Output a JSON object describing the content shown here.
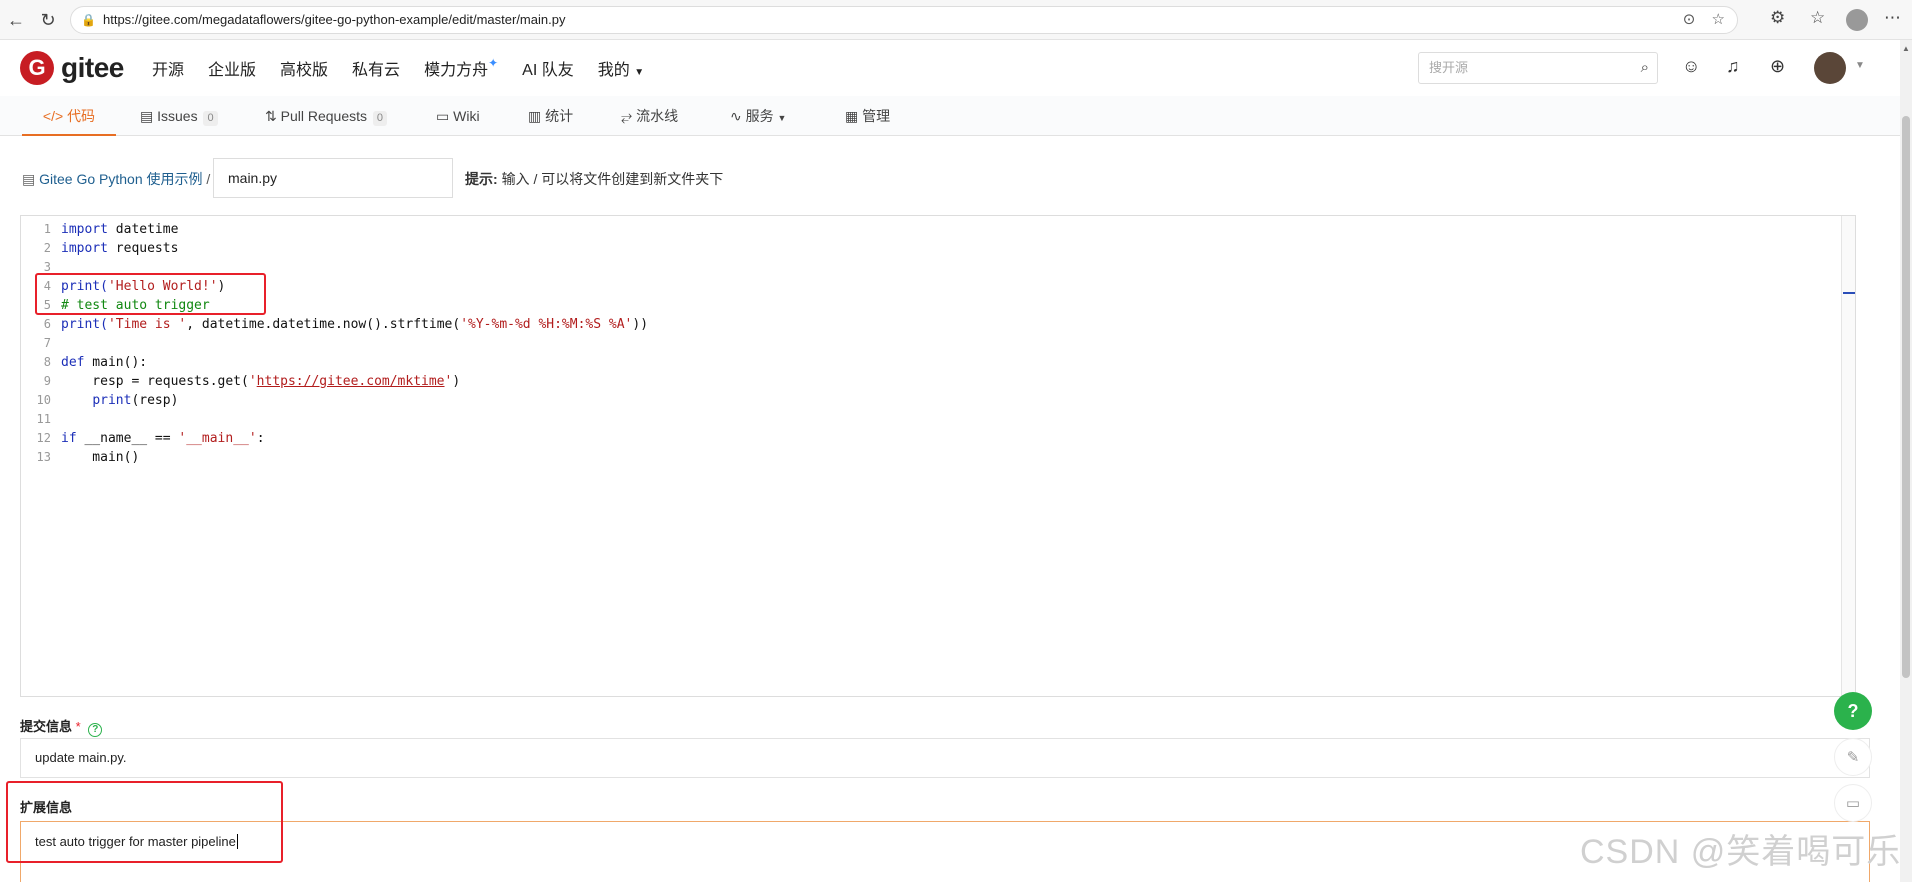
{
  "browser": {
    "url": "https://gitee.com/megadataflowers/gitee-go-python-example/edit/master/main.py"
  },
  "header": {
    "logo_mark": "G",
    "logo_text": "gitee",
    "nav": [
      "开源",
      "企业版",
      "高校版",
      "私有云",
      "模力方舟",
      "AI 队友",
      "我的"
    ],
    "search_placeholder": "搜开源"
  },
  "tabs": [
    {
      "label": "代码",
      "count": "",
      "icon": "code-icon"
    },
    {
      "label": "Issues",
      "count": "0",
      "icon": "issues-icon"
    },
    {
      "label": "Pull Requests",
      "count": "0",
      "icon": "pull-request-icon"
    },
    {
      "label": "Wiki",
      "count": "",
      "icon": "wiki-icon"
    },
    {
      "label": "统计",
      "count": "",
      "icon": "stats-icon"
    },
    {
      "label": "流水线",
      "count": "",
      "icon": "pipeline-icon"
    },
    {
      "label": "服务",
      "count": "",
      "icon": "service-icon"
    },
    {
      "label": "管理",
      "count": "",
      "icon": "manage-icon"
    }
  ],
  "breadcrumb": {
    "repo": "Gitee Go Python 使用示例",
    "separator": "/",
    "filename": "main.py"
  },
  "hint": {
    "label": "提示:",
    "text": "输入 / 可以将文件创建到新文件夹下"
  },
  "code": {
    "line_numbers": [
      "1",
      "2",
      "3",
      "4",
      "5",
      "6",
      "7",
      "8",
      "9",
      "10",
      "11",
      "12",
      "13"
    ],
    "l1_kw": "import",
    "l1_rest": " datetime",
    "l2_kw": "import",
    "l2_rest": " requests",
    "l4_fn": "print(",
    "l4_str": "'Hello World!'",
    "l4_end": ")",
    "l5_comment": "# test auto trigger",
    "l6_fn": "print(",
    "l6_str1": "'Time is '",
    "l6_mid": ", datetime.datetime.now().strftime(",
    "l6_str2": "'%Y-%m-%d %H:%M:%S %A'",
    "l6_end": "))",
    "l8_kw": "def",
    "l8_rest": " main():",
    "l9_pre": "    resp = requests.get(",
    "l9_q1": "'",
    "l9_link": "https://gitee.com/mktime",
    "l9_q2": "'",
    "l9_end": ")",
    "l10_pre": "    ",
    "l10_fn": "print",
    "l10_rest": "(resp)",
    "l12_kw": "if",
    "l12_mid": " __name__ == ",
    "l12_str": "'__main__'",
    "l12_end": ":",
    "l13": "    main()"
  },
  "commit": {
    "label": "提交信息",
    "required_mark": "*",
    "help_icon": "?",
    "value": "update main.py."
  },
  "extended": {
    "label": "扩展信息",
    "value": "test auto trigger for master pipeline"
  },
  "floating": {
    "help": "?"
  },
  "watermark": "CSDN @笑着喝可乐"
}
